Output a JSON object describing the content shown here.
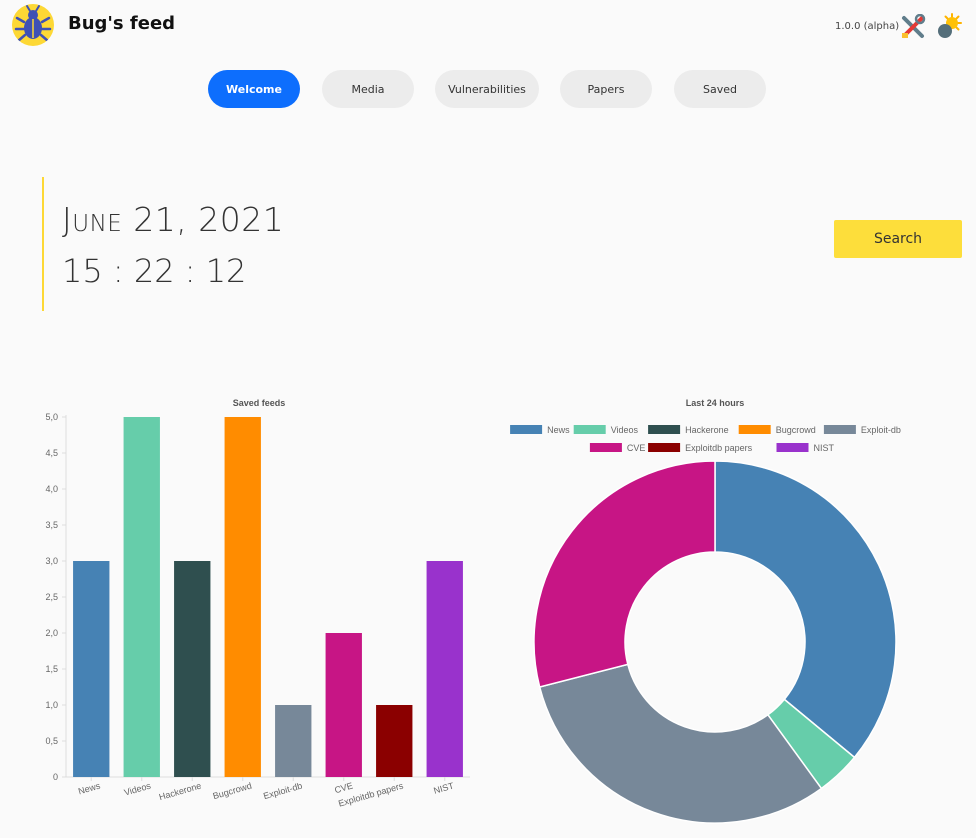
{
  "header": {
    "title": "Bug's feed",
    "version": "1.0.0 (alpha)",
    "logo_icon": "bug-icon",
    "tools_icon": "tools-icon",
    "theme_icon": "theme-toggle-icon"
  },
  "nav": {
    "tabs": [
      {
        "label": "Welcome",
        "active": true
      },
      {
        "label": "Media",
        "active": false
      },
      {
        "label": "Vulnerabilities",
        "active": false
      },
      {
        "label": "Papers",
        "active": false
      },
      {
        "label": "Saved",
        "active": false
      }
    ]
  },
  "welcome": {
    "date": "June 21, 2021",
    "time": "15 : 22 : 12",
    "search_label": "Search"
  },
  "colors": {
    "accent": "#0d6efd",
    "yellow": "#fdde3b",
    "News": "#4682b4",
    "Videos": "#66cdaa",
    "Hackerone": "#2f4f4f",
    "Bugcrowd": "#ff8c00",
    "Exploit-db": "#778899",
    "CVE": "#c71585",
    "Exploitdb papers": "#8b0000",
    "NIST": "#9932cc"
  },
  "chart_data": [
    {
      "type": "bar",
      "title": "Saved feeds",
      "categories": [
        "News",
        "Videos",
        "Hackerone",
        "Bugcrowd",
        "Exploit-db",
        "CVE",
        "Exploitdb papers",
        "NIST"
      ],
      "values": [
        3,
        5,
        3,
        5,
        1,
        2,
        1,
        3
      ],
      "yticks": [
        "0",
        "0,5",
        "1,0",
        "1,5",
        "2,0",
        "2,5",
        "3,0",
        "3,5",
        "4,0",
        "4,5",
        "5,0"
      ],
      "ylim": [
        0,
        5
      ],
      "grid": false
    },
    {
      "type": "pie",
      "title": "Last 24 hours",
      "legend": [
        "News",
        "Videos",
        "Hackerone",
        "Bugcrowd",
        "Exploit-db",
        "CVE",
        "Exploitdb papers",
        "NIST"
      ],
      "legend_placement": "top",
      "labels": [
        "News",
        "Videos",
        "Hackerone",
        "Bugcrowd",
        "Exploit-db",
        "CVE",
        "Exploitdb papers",
        "NIST"
      ],
      "values": [
        36,
        4,
        0,
        0,
        31,
        29,
        0,
        0
      ],
      "donut": true
    }
  ]
}
